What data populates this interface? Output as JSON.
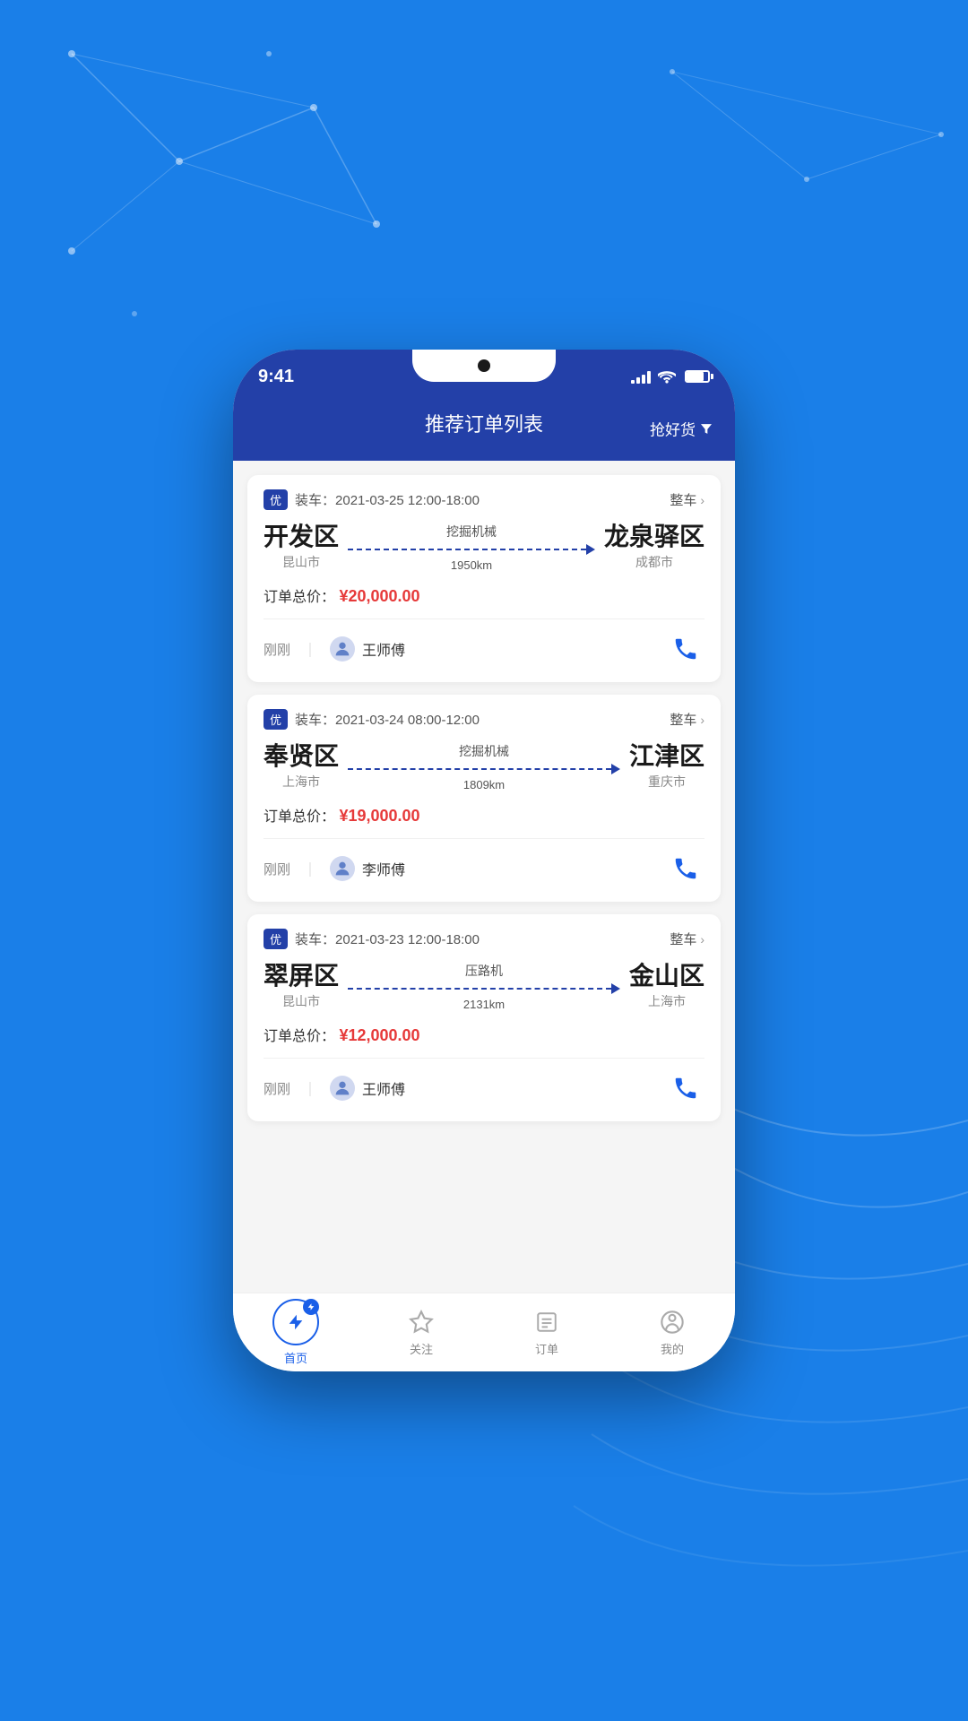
{
  "app": {
    "title": "推荐订单列表",
    "filter_label": "抢好货",
    "time": "9:41"
  },
  "orders": [
    {
      "badge": "优",
      "load_time": "装车：2021-03-25 12:00-18:00",
      "type": "整车",
      "from_name": "开发区",
      "from_city": "昆山市",
      "cargo": "挖掘机械",
      "distance": "1950km",
      "to_name": "龙泉驿区",
      "to_city": "成都市",
      "price_label": "订单总价：",
      "price": "¥20,000.00",
      "time_ago": "刚刚",
      "driver_name": "王师傅"
    },
    {
      "badge": "优",
      "load_time": "装车：2021-03-24 08:00-12:00",
      "type": "整车",
      "from_name": "奉贤区",
      "from_city": "上海市",
      "cargo": "挖掘机械",
      "distance": "1809km",
      "to_name": "江津区",
      "to_city": "重庆市",
      "price_label": "订单总价：",
      "price": "¥19,000.00",
      "time_ago": "刚刚",
      "driver_name": "李师傅"
    },
    {
      "badge": "优",
      "load_time": "装车：2021-03-23 12:00-18:00",
      "type": "整车",
      "from_name": "翠屏区",
      "from_city": "昆山市",
      "cargo": "压路机",
      "distance": "2131km",
      "to_name": "金山区",
      "to_city": "上海市",
      "price_label": "订单总价：",
      "price": "¥12,000.00",
      "time_ago": "刚刚",
      "driver_name": "王师傅"
    }
  ],
  "nav": {
    "items": [
      {
        "label": "首页",
        "active": true
      },
      {
        "label": "关注",
        "active": false
      },
      {
        "label": "订单",
        "active": false
      },
      {
        "label": "我的",
        "active": false
      }
    ]
  }
}
